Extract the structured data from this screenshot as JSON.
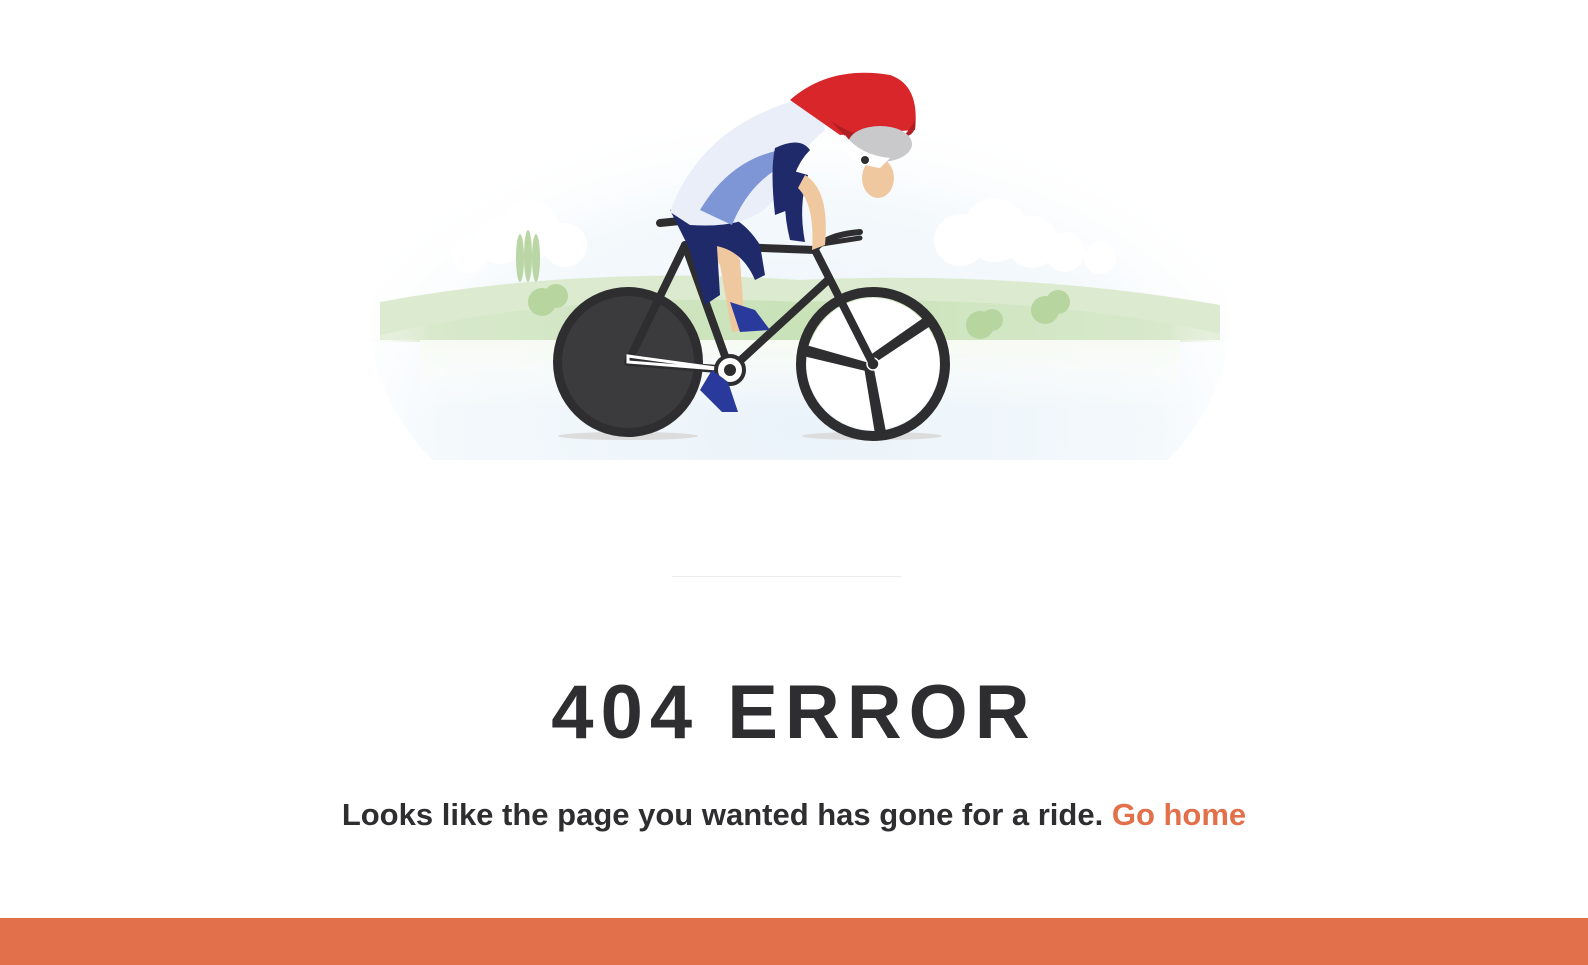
{
  "illustration": {
    "icon": "cyclist-illustration",
    "colors": {
      "helmet": "#d8262b",
      "jersey": "#1f2a6b",
      "jersey_light": "#7e96d6",
      "wheel": "#2e2e30",
      "grass": "#c6e0b4",
      "sky": "#eef5fa"
    }
  },
  "error": {
    "title": "404 ERROR",
    "message": "Looks like the page you wanted has gone for a ride.",
    "link_label": "Go home"
  },
  "colors": {
    "text": "#2e2e30",
    "accent": "#e2704b",
    "divider": "#ececec"
  }
}
